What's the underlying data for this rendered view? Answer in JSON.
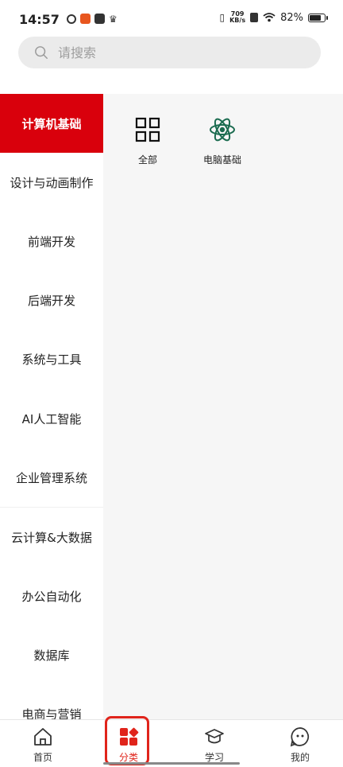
{
  "status": {
    "time": "14:57",
    "net_speed_value": "709",
    "net_speed_unit": "KB/s",
    "battery_percent": "82%",
    "battery_level": 0.82
  },
  "search": {
    "placeholder": "请搜索"
  },
  "sidebar": {
    "items": [
      {
        "label": "计算机基础",
        "active": true
      },
      {
        "label": "设计与动画制作"
      },
      {
        "label": "前端开发"
      },
      {
        "label": "后端开发"
      },
      {
        "label": "系统与工具"
      },
      {
        "label": "AI人工智能"
      },
      {
        "label": "企业管理系统"
      },
      {
        "label": "云计算&大数据"
      },
      {
        "label": "办公自动化"
      },
      {
        "label": "数据库"
      },
      {
        "label": "电商与营销"
      }
    ]
  },
  "subcategories": [
    {
      "label": "全部",
      "icon": "grid-icon"
    },
    {
      "label": "电脑基础",
      "icon": "atom-icon"
    }
  ],
  "nav": {
    "items": [
      {
        "label": "首页",
        "icon": "home-icon"
      },
      {
        "label": "分类",
        "icon": "category-icon"
      },
      {
        "label": "学习",
        "icon": "graduation-cap-icon"
      },
      {
        "label": "我的",
        "icon": "profile-icon"
      }
    ]
  },
  "colors": {
    "accent": "#d9000c",
    "atom": "#1a6b4f"
  }
}
